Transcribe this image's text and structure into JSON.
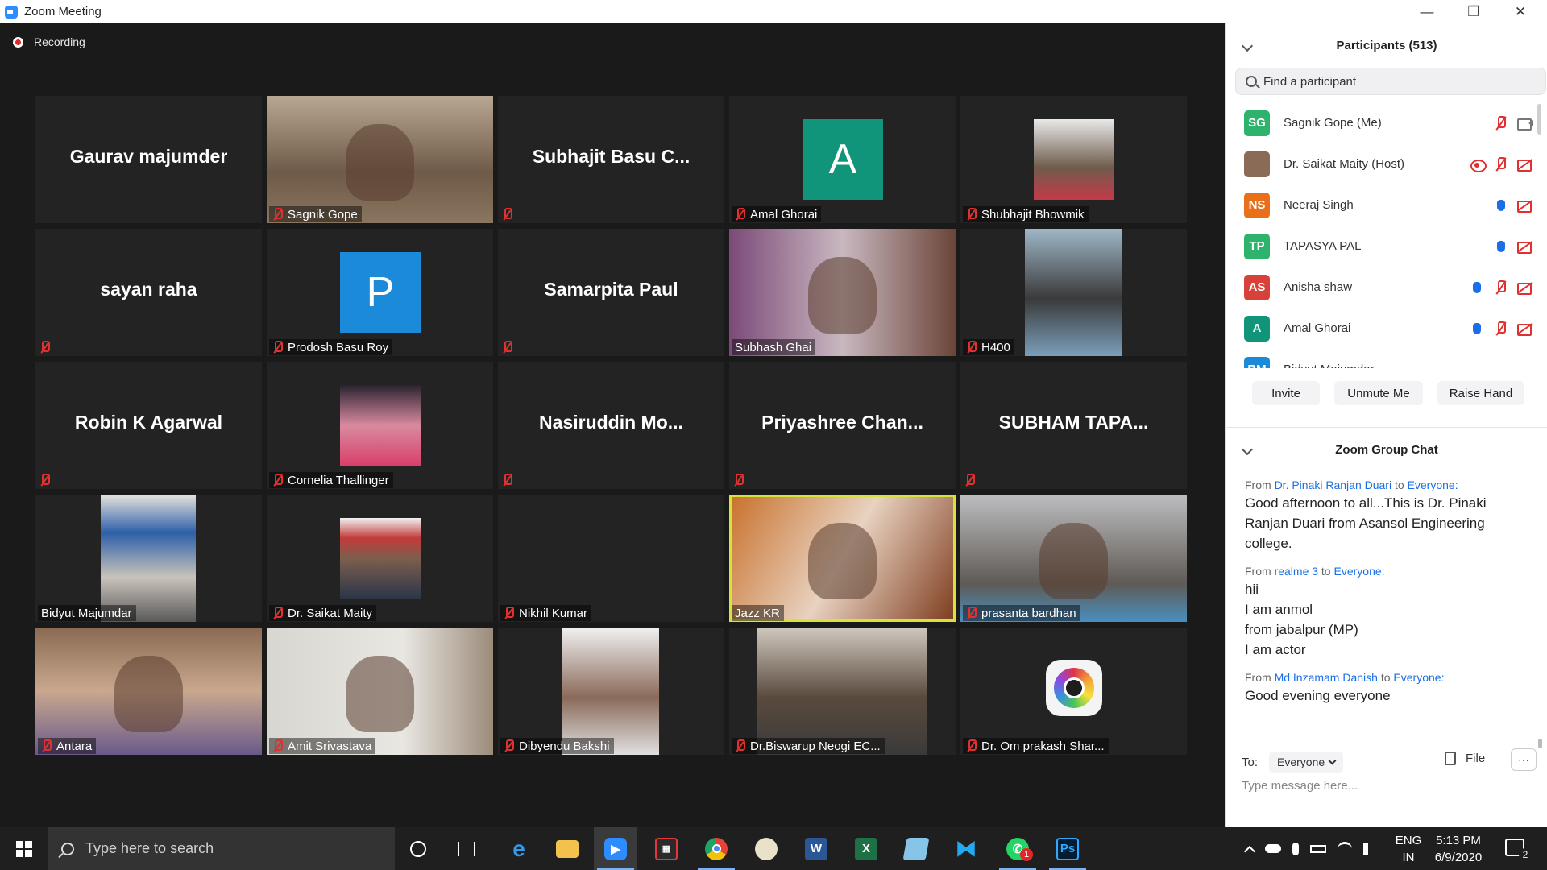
{
  "window": {
    "title": "Zoom Meeting",
    "minimize": "—",
    "maximize": "❐",
    "close": "✕"
  },
  "recording": {
    "label": "Recording"
  },
  "tiles": [
    {
      "name": "Gaurav majumder",
      "label": "",
      "bigname": "Gaurav majumder",
      "muted": false,
      "kind": "name"
    },
    {
      "name": "Sagnik Gope",
      "label": "Sagnik Gope",
      "muted": true,
      "kind": "video"
    },
    {
      "name": "Subhajit Basu C...",
      "label": "",
      "bigname": "Subhajit  Basu  C...",
      "muted": true,
      "kind": "name"
    },
    {
      "name": "Amal Ghorai",
      "label": "Amal Ghorai",
      "muted": true,
      "kind": "avatar",
      "avatar_letter": "A",
      "avatar_color": "#11957a"
    },
    {
      "name": "Shubhajit Bhowmik",
      "label": "Shubhajit Bhowmik",
      "muted": true,
      "kind": "photo"
    },
    {
      "name": "sayan raha",
      "label": "",
      "bigname": "sayan raha",
      "muted": true,
      "kind": "name"
    },
    {
      "name": "Prodosh Basu Roy",
      "label": "Prodosh Basu Roy",
      "muted": true,
      "kind": "avatar",
      "avatar_letter": "P",
      "avatar_color": "#1b8ad8"
    },
    {
      "name": "Samarpita Paul",
      "label": "",
      "bigname": "Samarpita Paul",
      "muted": true,
      "kind": "name"
    },
    {
      "name": "Subhash Ghai",
      "label": "Subhash Ghai",
      "muted": false,
      "kind": "video"
    },
    {
      "name": "H400",
      "label": "H400",
      "muted": true,
      "kind": "photo"
    },
    {
      "name": "Robin K Agarwal",
      "label": "",
      "bigname": "Robin K Agarwal",
      "muted": true,
      "kind": "name"
    },
    {
      "name": "Cornelia Thallinger",
      "label": "Cornelia Thallinger",
      "muted": true,
      "kind": "photo"
    },
    {
      "name": "Nasiruddin Mo...",
      "label": "",
      "bigname": "Nasiruddin  Mo...",
      "muted": true,
      "kind": "name"
    },
    {
      "name": "Priyashree Chan...",
      "label": "",
      "bigname": "Priyashree  Chan...",
      "muted": true,
      "kind": "name"
    },
    {
      "name": "SUBHAM TAPA...",
      "label": "",
      "bigname": "SUBHAM  TAPA...",
      "muted": true,
      "kind": "name"
    },
    {
      "name": "Bidyut Majumdar",
      "label": "Bidyut Majumdar",
      "muted": false,
      "kind": "photo"
    },
    {
      "name": "Dr. Saikat Maity",
      "label": "Dr. Saikat Maity",
      "muted": true,
      "kind": "photo"
    },
    {
      "name": "Nikhil Kumar",
      "label": "Nikhil Kumar",
      "muted": true,
      "kind": "blank"
    },
    {
      "name": "Jazz KR",
      "label": "Jazz KR",
      "muted": false,
      "kind": "video",
      "active": true
    },
    {
      "name": "prasanta bardhan",
      "label": "prasanta bardhan",
      "muted": true,
      "kind": "video"
    },
    {
      "name": "Antara",
      "label": "Antara",
      "muted": true,
      "kind": "video"
    },
    {
      "name": "Amit Srivastava",
      "label": "Amit Srivastava",
      "muted": true,
      "kind": "video"
    },
    {
      "name": "Dibyendu Bakshi",
      "label": "Dibyendu Bakshi",
      "muted": true,
      "kind": "photo"
    },
    {
      "name": "Dr.Biswarup Neogi EC...",
      "label": "Dr.Biswarup Neogi EC...",
      "muted": true,
      "kind": "photo"
    },
    {
      "name": "Dr. Om prakash Shar...",
      "label": "Dr. Om prakash Shar...",
      "muted": true,
      "kind": "logo"
    }
  ],
  "participants_panel": {
    "title": "Participants (513)",
    "search_placeholder": "Find a participant",
    "participants": [
      {
        "initials": "SG",
        "name": "Sagnik Gope (Me)",
        "color": "#2db36b",
        "icons": [
          "micoff",
          "vidon"
        ]
      },
      {
        "initials": "",
        "name": "Dr. Saikat Maity (Host)",
        "color": "#8a6b55",
        "icons": [
          "rec",
          "micoff",
          "vidoff"
        ]
      },
      {
        "initials": "NS",
        "name": "Neeraj Singh",
        "color": "#e8701a",
        "icons": [
          "hand",
          "vidoff"
        ]
      },
      {
        "initials": "TP",
        "name": "TAPASYA PAL",
        "color": "#2db36b",
        "icons": [
          "hand",
          "vidoff"
        ]
      },
      {
        "initials": "AS",
        "name": "Anisha shaw",
        "color": "#d8413a",
        "icons": [
          "hand",
          "micoff",
          "vidoff"
        ]
      },
      {
        "initials": "A",
        "name": "Amal Ghorai",
        "color": "#11957a",
        "icons": [
          "hand",
          "micoff",
          "vidoff"
        ]
      },
      {
        "initials": "BM",
        "name": "Bidyut Majumdar",
        "color": "#1b8ad8",
        "icons": []
      }
    ],
    "buttons": {
      "invite": "Invite",
      "unmute": "Unmute Me",
      "raise_hand": "Raise Hand"
    }
  },
  "chat_panel": {
    "title": "Zoom Group Chat",
    "messages": [
      {
        "from_prefix": "From",
        "from": "Dr. Pinaki Ranjan Duari",
        "to_prefix": "to",
        "to": "Everyone:",
        "lines": [
          "Good afternoon to all...This is Dr. Pinaki Ranjan Duari from Asansol Engineering college."
        ]
      },
      {
        "from_prefix": "From",
        "from": "realme 3",
        "to_prefix": "to",
        "to": "Everyone:",
        "lines": [
          "hii",
          "I am anmol",
          "from jabalpur (MP)",
          "I am actor"
        ]
      },
      {
        "from_prefix": "From",
        "from": "Md Inzamam Danish",
        "to_prefix": "to",
        "to": "Everyone:",
        "lines": [
          "Good evening everyone"
        ]
      }
    ],
    "to_label": "To:",
    "to_value": "Everyone",
    "file_label": "File",
    "more_label": "···",
    "input_placeholder": "Type message here..."
  },
  "taskbar": {
    "search_placeholder": "Type here to search",
    "apps": [
      "task-view",
      "edge",
      "file-explorer",
      "zoom",
      "filmora",
      "chrome",
      "paint",
      "word",
      "excel",
      "notepad",
      "vscode",
      "whatsapp",
      "photoshop"
    ],
    "whatsapp_badge": "1",
    "lang_top": "ENG",
    "lang_bottom": "IN",
    "time": "5:13 PM",
    "date": "6/9/2020",
    "notifications": "2"
  }
}
